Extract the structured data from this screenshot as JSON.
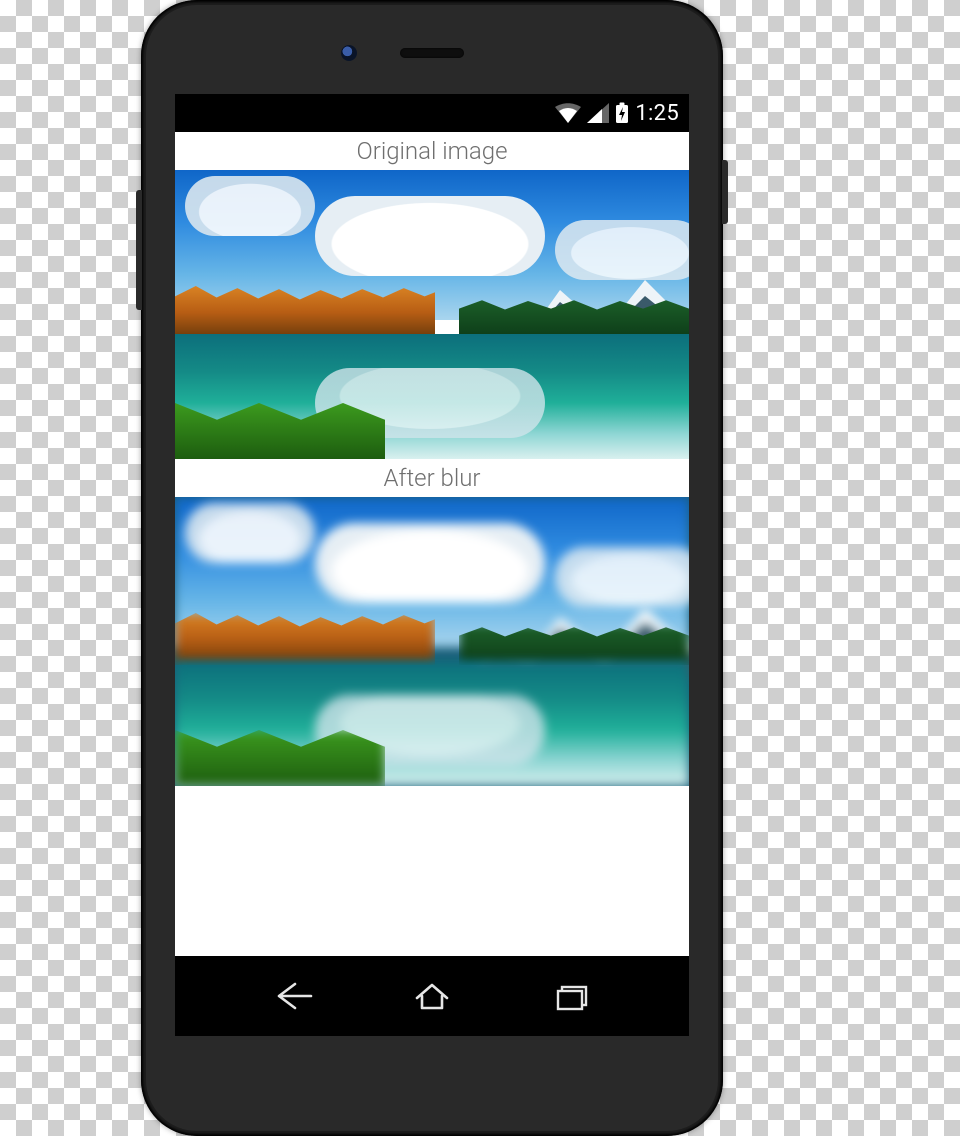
{
  "statusbar": {
    "time": "1:25"
  },
  "captions": {
    "original": "Original image",
    "after": "After blur"
  },
  "nav_icons": {
    "back": "back-icon",
    "home": "home-icon",
    "recent": "recent-apps-icon"
  },
  "status_icons": {
    "wifi": "wifi-icon",
    "signal": "cell-signal-icon",
    "battery": "battery-charging-icon"
  }
}
